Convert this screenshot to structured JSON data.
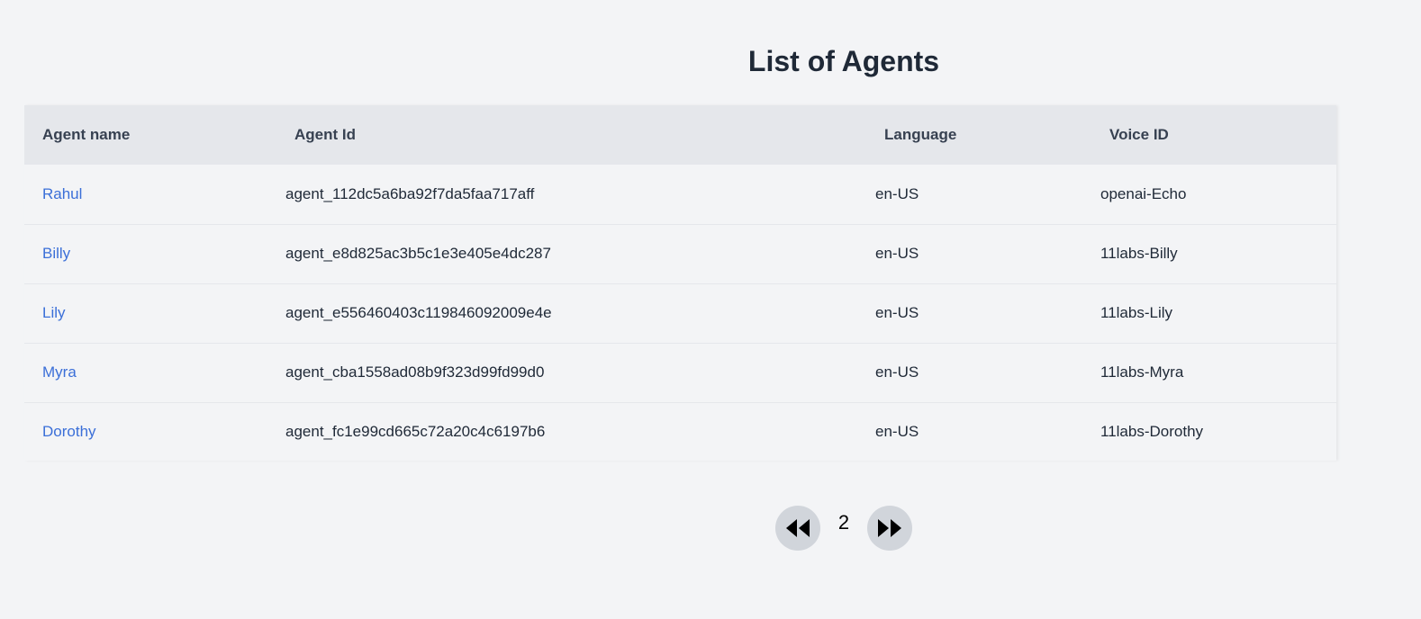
{
  "page": {
    "title": "List of Agents"
  },
  "table": {
    "headers": [
      "Agent name",
      "Agent Id",
      "Language",
      "Voice ID"
    ],
    "rows": [
      {
        "name": "Rahul",
        "id": "agent_112dc5a6ba92f7da5faa717aff",
        "language": "en-US",
        "voice": "openai-Echo"
      },
      {
        "name": "Billy",
        "id": "agent_e8d825ac3b5c1e3e405e4dc287",
        "language": "en-US",
        "voice": "11labs-Billy"
      },
      {
        "name": "Lily",
        "id": "agent_e556460403c119846092009e4e",
        "language": "en-US",
        "voice": "11labs-Lily"
      },
      {
        "name": "Myra",
        "id": "agent_cba1558ad08b9f323d99fd99d0",
        "language": "en-US",
        "voice": "11labs-Myra"
      },
      {
        "name": "Dorothy",
        "id": "agent_fc1e99cd665c72a20c4c6197b6",
        "language": "en-US",
        "voice": "11labs-Dorothy"
      }
    ]
  },
  "pagination": {
    "current_page": "2",
    "prev_icon": "rewind-icon",
    "next_icon": "fast-forward-icon"
  },
  "colors": {
    "background": "#f3f4f6",
    "header_bg": "#e5e7eb",
    "link": "#3b6fd8",
    "pager_button": "#d1d5db"
  }
}
